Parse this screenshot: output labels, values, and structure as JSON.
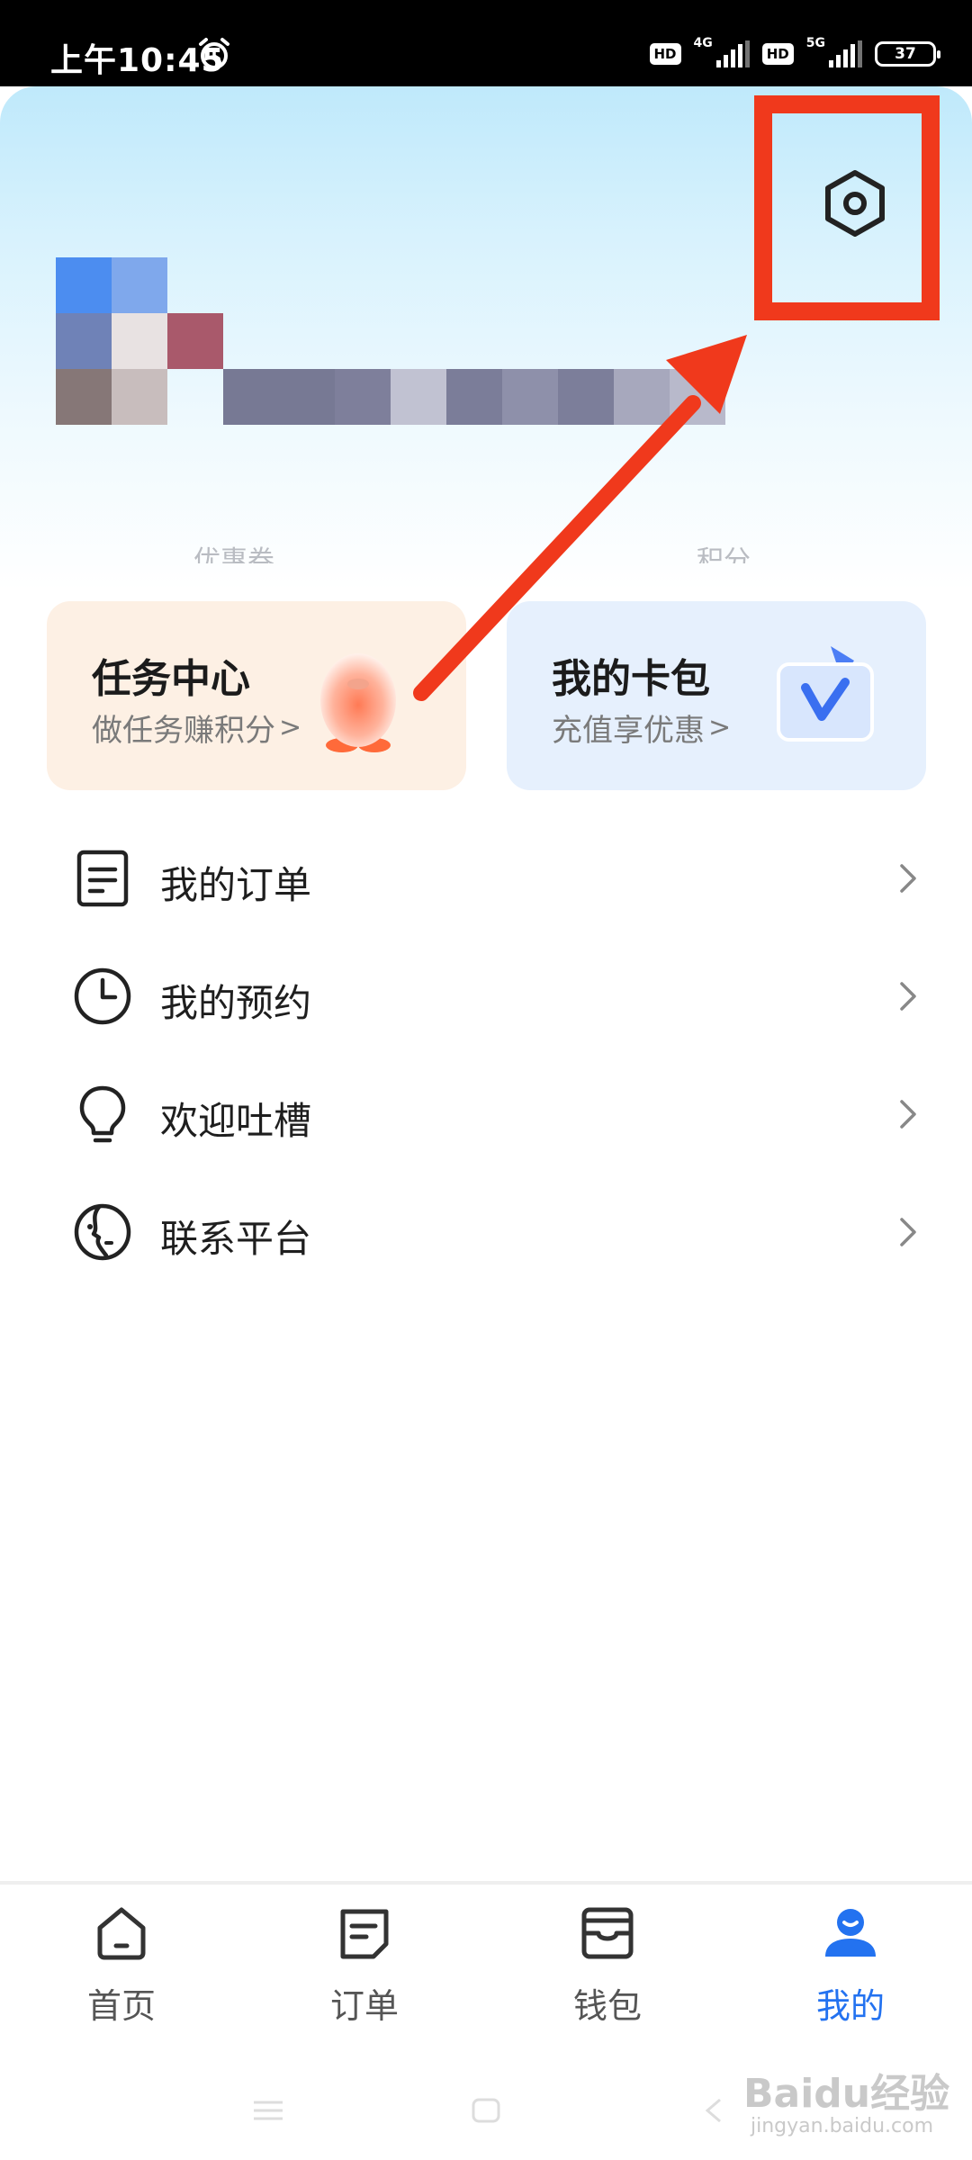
{
  "status_bar": {
    "time": "上午10:45",
    "hd1": "HD",
    "net1": "4G",
    "hd2": "HD",
    "net2": "5G",
    "battery": "37"
  },
  "header": {
    "settings_icon": "hexagon-gear-icon",
    "stats": {
      "coupon_label": "优惠券",
      "points_label": "积分"
    }
  },
  "cards": {
    "task": {
      "title": "任务中心",
      "subtitle": "做任务赚积分",
      "arrow": ">"
    },
    "wallet": {
      "title": "我的卡包",
      "subtitle": "充值享优惠",
      "arrow": ">"
    }
  },
  "menu": [
    {
      "label": "我的订单",
      "icon": "document-icon"
    },
    {
      "label": "我的预约",
      "icon": "clock-icon"
    },
    {
      "label": "欢迎吐槽",
      "icon": "lightbulb-icon"
    },
    {
      "label": "联系平台",
      "icon": "face-icon"
    }
  ],
  "tabbar": [
    {
      "label": "首页",
      "icon": "home-icon",
      "active": false
    },
    {
      "label": "订单",
      "icon": "order-icon",
      "active": false
    },
    {
      "label": "钱包",
      "icon": "wallet-icon",
      "active": false
    },
    {
      "label": "我的",
      "icon": "profile-icon",
      "active": true
    }
  ],
  "watermark": {
    "brand": "Baidu经验",
    "url": "jingyan.baidu.com"
  },
  "colors": {
    "accent": "#2372f0",
    "highlight": "#f0391c",
    "task_card_bg": "#fdf0e4",
    "wallet_card_bg": "#e6f0fd"
  }
}
